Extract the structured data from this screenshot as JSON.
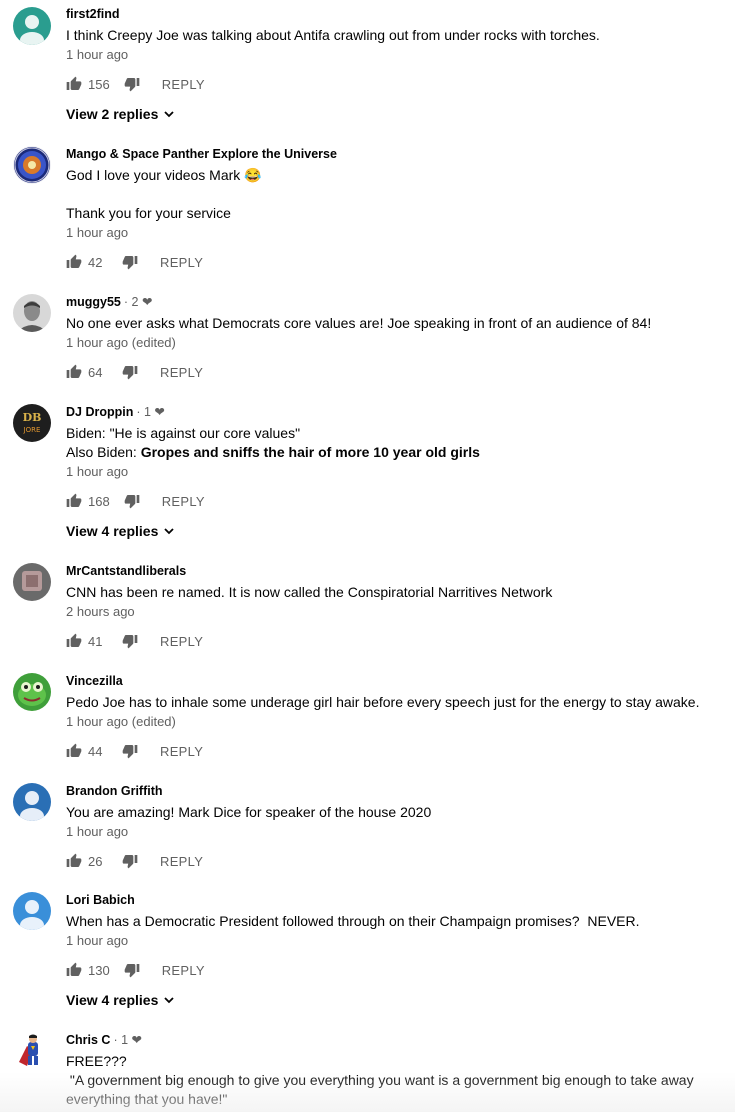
{
  "comments": [
    {
      "author": "first2find",
      "heart": "",
      "text": "I think Creepy Joe was talking about Antifa crawling out from under rocks with torches.",
      "time": "1 hour ago",
      "likes": "156",
      "reply": "REPLY",
      "view_replies": "View 2 replies",
      "avatar": "default-teal-avatar"
    },
    {
      "author": "Mango & Space Panther Explore the Universe",
      "heart": "",
      "text": "God I love your videos Mark 😂\n\nThank you for your service",
      "time": "1 hour ago",
      "likes": "42",
      "reply": "REPLY",
      "avatar": "mission-patch-avatar"
    },
    {
      "author": "muggy55",
      "heart": "· 2 ❤",
      "text": "No one ever asks what Democrats core values are! Joe speaking in front of an audience of 84!",
      "time": "1 hour ago (edited)",
      "likes": "64",
      "reply": "REPLY",
      "avatar": "man-photo-avatar"
    },
    {
      "author": "DJ Droppin",
      "heart": "· 1 ❤",
      "text_line1": "Biden: \"He is against our core values\"",
      "text_prefix": "Also Biden: ",
      "text_bold": "Gropes and sniffs the hair of more 10 year old girls",
      "time": "1 hour ago",
      "likes": "168",
      "reply": "REPLY",
      "view_replies": "View 4 replies",
      "avatar": "dj-logo-avatar"
    },
    {
      "author": "MrCantstandliberals",
      "heart": "",
      "text": "CNN has been re named. It is now called the Conspiratorial Narritives Network",
      "time": "2 hours ago",
      "likes": "41",
      "reply": "REPLY",
      "avatar": "photo-avatar"
    },
    {
      "author": "Vincezilla",
      "heart": "",
      "text": "Pedo Joe has to inhale some underage girl hair before every speech just for the energy to stay awake.",
      "time": "1 hour ago (edited)",
      "likes": "44",
      "reply": "REPLY",
      "avatar": "frog-avatar"
    },
    {
      "author": "Brandon Griffith",
      "heart": "",
      "text": "You are amazing! Mark Dice for speaker of the house 2020",
      "time": "1 hour ago",
      "likes": "26",
      "reply": "REPLY",
      "avatar": "default-blue-avatar"
    },
    {
      "author": "Lori Babich",
      "heart": "",
      "text": "When has a Democratic President followed through on their Champaign promises?  NEVER.",
      "time": "1 hour ago",
      "likes": "130",
      "reply": "REPLY",
      "view_replies": "View 4 replies",
      "avatar": "default-lightblue-avatar"
    },
    {
      "author": "Chris C",
      "heart": "· 1 ❤",
      "text": "FREE???\n \"A government big enough to give you everything you want is a government big enough to take away everything that you have!\"",
      "avatar": "superman-avatar"
    }
  ],
  "colors": {
    "text": "#030303",
    "meta": "#606060",
    "teal": "#2a9d8f",
    "blue": "#2a6fb5",
    "lightblue": "#3a8fd9"
  }
}
